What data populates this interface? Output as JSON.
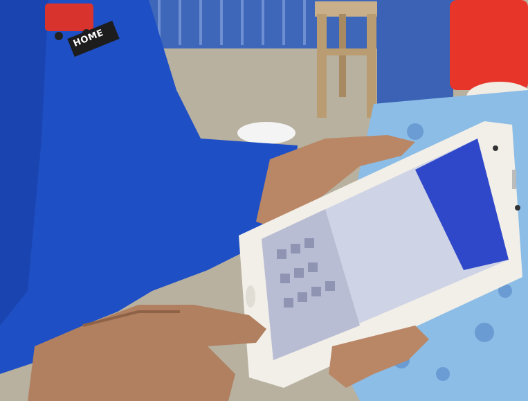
{
  "scene": {
    "description_tags": [
      "person-in-blue-shirt",
      "smartphone",
      "hand",
      "table",
      "chair"
    ],
    "shirt_logo": {
      "text": "HOME",
      "colors": {
        "logo_red": "#d8332c",
        "shirt_blue": "#1f4fc4"
      }
    },
    "phone": {
      "body_color": "#f2efe8",
      "screen_header_color": "#2f48c9"
    },
    "colors": {
      "floor": "#bdb6a6",
      "wall": "#3a63b8",
      "tablecloth": "#8fc1e8",
      "bucket": "#e8352a",
      "skin": "#b98766"
    }
  }
}
